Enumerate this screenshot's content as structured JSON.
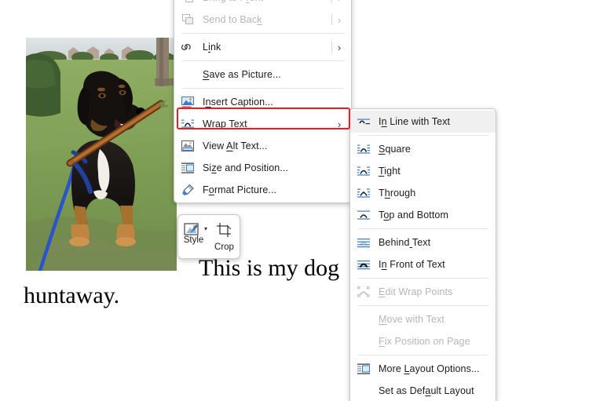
{
  "document": {
    "line1": "This is my dog      e is a bor",
    "line2": "huntaway.",
    "picture_alt": "dog-photo"
  },
  "context_menu": {
    "items": [
      {
        "label": "Bring to Front",
        "icon": "bring-to-front-icon",
        "disabled": true,
        "submenu_arrow": "›",
        "accel_sep": true
      },
      {
        "label": "Send to Back",
        "icon": "send-to-back-icon",
        "disabled": true,
        "submenu_arrow": "›",
        "accel_sep": true
      },
      {
        "separator": true
      },
      {
        "label": "Link",
        "icon": "link-icon",
        "disabled": false,
        "submenu_arrow": "›",
        "accel_sep": true
      },
      {
        "separator": true
      },
      {
        "label": "Save as Picture...",
        "icon": "none",
        "disabled": false
      },
      {
        "separator": true
      },
      {
        "label": "Insert Caption...",
        "icon": "insert-caption-icon",
        "disabled": false
      },
      {
        "label": "Wrap Text",
        "icon": "wrap-text-icon",
        "disabled": false,
        "submenu_arrow": "›",
        "highlighted": true
      },
      {
        "label": "View Alt Text...",
        "icon": "alt-text-icon",
        "disabled": false
      },
      {
        "label": "Size and Position...",
        "icon": "size-position-icon",
        "disabled": false
      },
      {
        "label": "Format Picture...",
        "icon": "format-picture-icon",
        "disabled": false
      }
    ],
    "highlight_color": "#ec1c24"
  },
  "wrap_submenu": {
    "items": [
      {
        "label": "In Line with Text",
        "icon": "wrap-inline-icon",
        "disabled": false,
        "hover": true
      },
      {
        "separator": true
      },
      {
        "label": "Square",
        "icon": "wrap-square-icon",
        "disabled": false
      },
      {
        "label": "Tight",
        "icon": "wrap-tight-icon",
        "disabled": false
      },
      {
        "label": "Through",
        "icon": "wrap-through-icon",
        "disabled": false
      },
      {
        "label": "Top and Bottom",
        "icon": "wrap-topbottom-icon",
        "disabled": false
      },
      {
        "separator": true
      },
      {
        "label": "Behind Text",
        "icon": "wrap-behind-icon",
        "disabled": false
      },
      {
        "label": "In Front of Text",
        "icon": "wrap-front-icon",
        "disabled": false
      },
      {
        "separator": true
      },
      {
        "label": "Edit Wrap Points",
        "icon": "edit-wrap-points-icon",
        "disabled": true
      },
      {
        "separator": true
      },
      {
        "label": "Move with Text",
        "icon": "none",
        "disabled": true
      },
      {
        "label": "Fix Position on Page",
        "icon": "none",
        "disabled": true
      },
      {
        "separator": true
      },
      {
        "label": "More Layout Options...",
        "icon": "more-layout-icon",
        "disabled": false
      },
      {
        "label": "Set as Default Layout",
        "icon": "none",
        "disabled": false
      }
    ]
  },
  "mini_toolbar": {
    "buttons": [
      {
        "label": "Style",
        "icon": "picture-style-icon",
        "has_dropdown": true
      },
      {
        "label": "Crop",
        "icon": "crop-icon",
        "has_dropdown": false
      }
    ]
  }
}
